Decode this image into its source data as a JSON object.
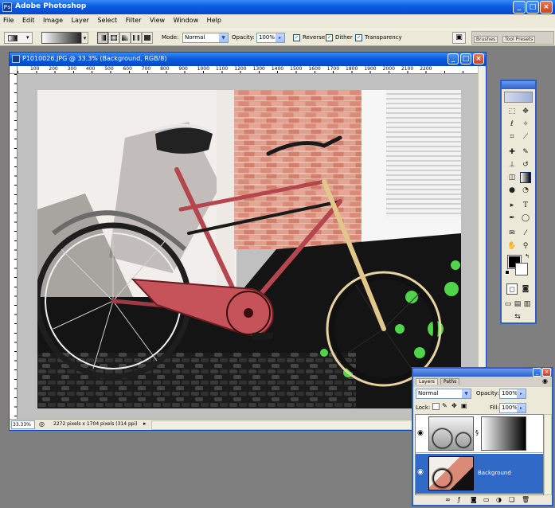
{
  "app": {
    "title": "Adobe Photoshop",
    "window_buttons": {
      "minimize": "_",
      "maximize": "□",
      "close": "×"
    }
  },
  "menu": [
    "File",
    "Edit",
    "Image",
    "Layer",
    "Select",
    "Filter",
    "View",
    "Window",
    "Help"
  ],
  "options_bar": {
    "mode_label": "Mode:",
    "mode_value": "Normal",
    "opacity_label": "Opacity:",
    "opacity_value": "100%",
    "reverse_label": "Reverse",
    "dither_label": "Dither",
    "transparency_label": "Transparency",
    "palette_tabs": [
      "Brushes",
      "Tool Presets"
    ]
  },
  "document": {
    "title": "P1010026.JPG @ 33.3% (Background, RGB/8)",
    "zoom": "33.33%",
    "status": "2272 pixels x 1704 pixels (314 ppi)",
    "ruler_labels": [
      "100",
      "200",
      "300",
      "400",
      "500",
      "600",
      "700",
      "800",
      "900",
      "1000",
      "1100",
      "1200",
      "1300",
      "1400",
      "1500",
      "1600",
      "1700",
      "1800",
      "1900",
      "2000",
      "2100",
      "2200"
    ]
  },
  "layers_panel": {
    "tabs": [
      "Layers",
      "Paths"
    ],
    "blend_mode": "Normal",
    "opacity_label": "Opacity:",
    "opacity_value": "100%",
    "lock_label": "Lock:",
    "fill_label": "Fill:",
    "fill_value": "100%",
    "layers": [
      {
        "name": "",
        "selected": false
      },
      {
        "name": "Background",
        "selected": true
      }
    ]
  },
  "colors": {
    "accent": "#0a5ce0",
    "selection": "#3169c6",
    "panel": "#ece9d8",
    "workspace": "#7f7f7f"
  }
}
